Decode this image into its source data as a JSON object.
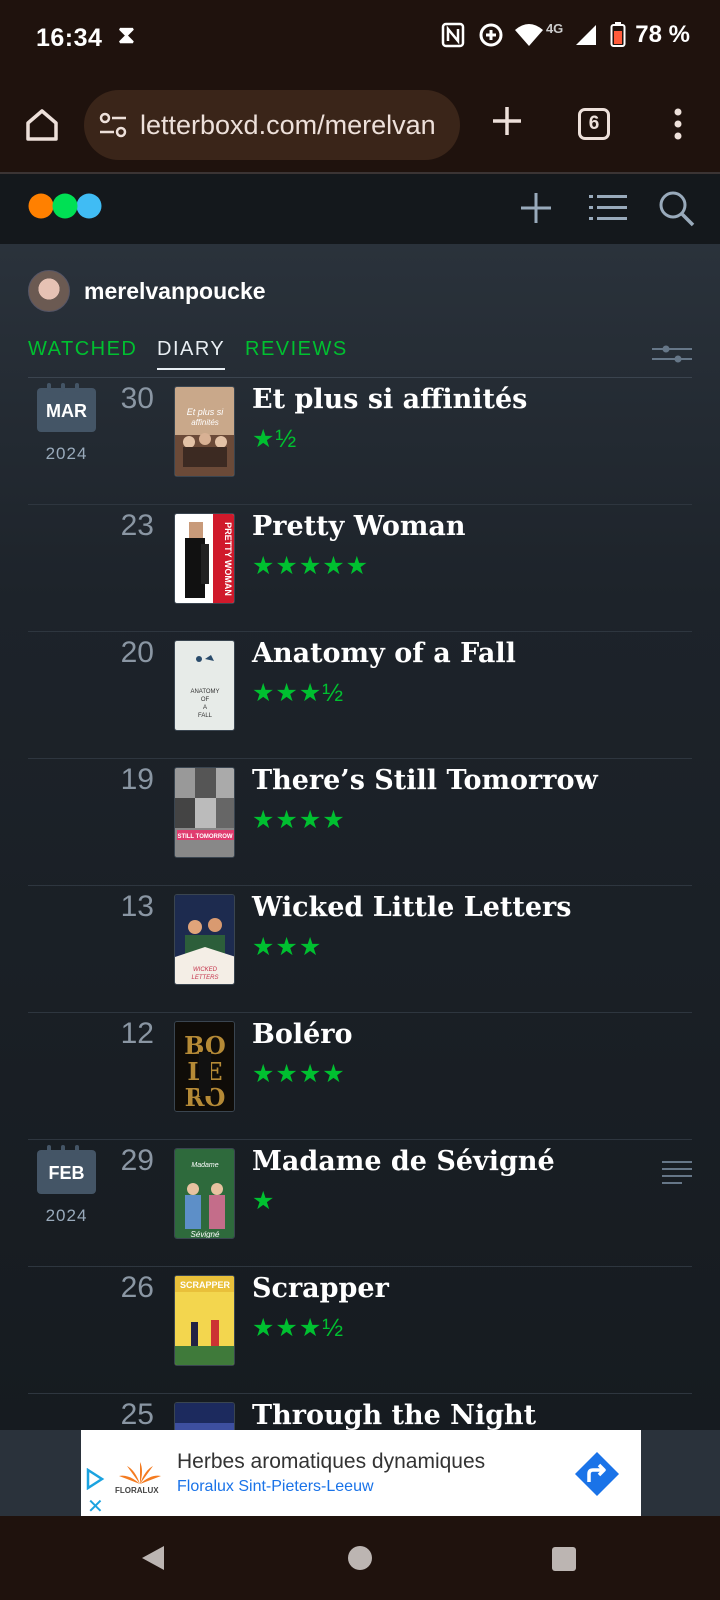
{
  "status_bar": {
    "time": "16:34",
    "battery": "78 %",
    "network": "4G"
  },
  "browser": {
    "url": "letterboxd.com/merelvan",
    "tab_count": "6"
  },
  "profile": {
    "username": "merelvanpoucke"
  },
  "tabs": [
    {
      "label": "WATCHED"
    },
    {
      "label": "DIARY"
    },
    {
      "label": "REVIEWS"
    }
  ],
  "diary": [
    {
      "month": "MAR",
      "year": "2024",
      "day": "30",
      "title": "Et plus si affinités",
      "rating": "★½",
      "has_review": false
    },
    {
      "month": "",
      "year": "",
      "day": "23",
      "title": "Pretty Woman",
      "rating": "★★★★★",
      "has_review": false
    },
    {
      "month": "",
      "year": "",
      "day": "20",
      "title": "Anatomy of a Fall",
      "rating": "★★★½",
      "has_review": false
    },
    {
      "month": "",
      "year": "",
      "day": "19",
      "title": "There’s Still Tomorrow",
      "rating": "★★★★",
      "has_review": false
    },
    {
      "month": "",
      "year": "",
      "day": "13",
      "title": "Wicked Little Letters",
      "rating": "★★★",
      "has_review": false
    },
    {
      "month": "",
      "year": "",
      "day": "12",
      "title": "Boléro",
      "rating": "★★★★",
      "has_review": false
    },
    {
      "month": "FEB",
      "year": "2024",
      "day": "29",
      "title": "Madame de Sévigné",
      "rating": "★",
      "has_review": true
    },
    {
      "month": "",
      "year": "",
      "day": "26",
      "title": "Scrapper",
      "rating": "★★★½",
      "has_review": false
    },
    {
      "month": "",
      "year": "",
      "day": "25",
      "title": "Through the Night",
      "rating": "",
      "has_review": false
    }
  ],
  "ad": {
    "headline": "Herbes aromatiques dynamiques",
    "subline": "Floralux Sint-Pieters-Leeuw",
    "brand": "FLORALUX"
  },
  "colors": {
    "accent_green": "#00c030",
    "logo_orange": "#ff8000",
    "logo_green": "#00e054",
    "logo_blue": "#40bcf4",
    "background": "#14181c"
  }
}
